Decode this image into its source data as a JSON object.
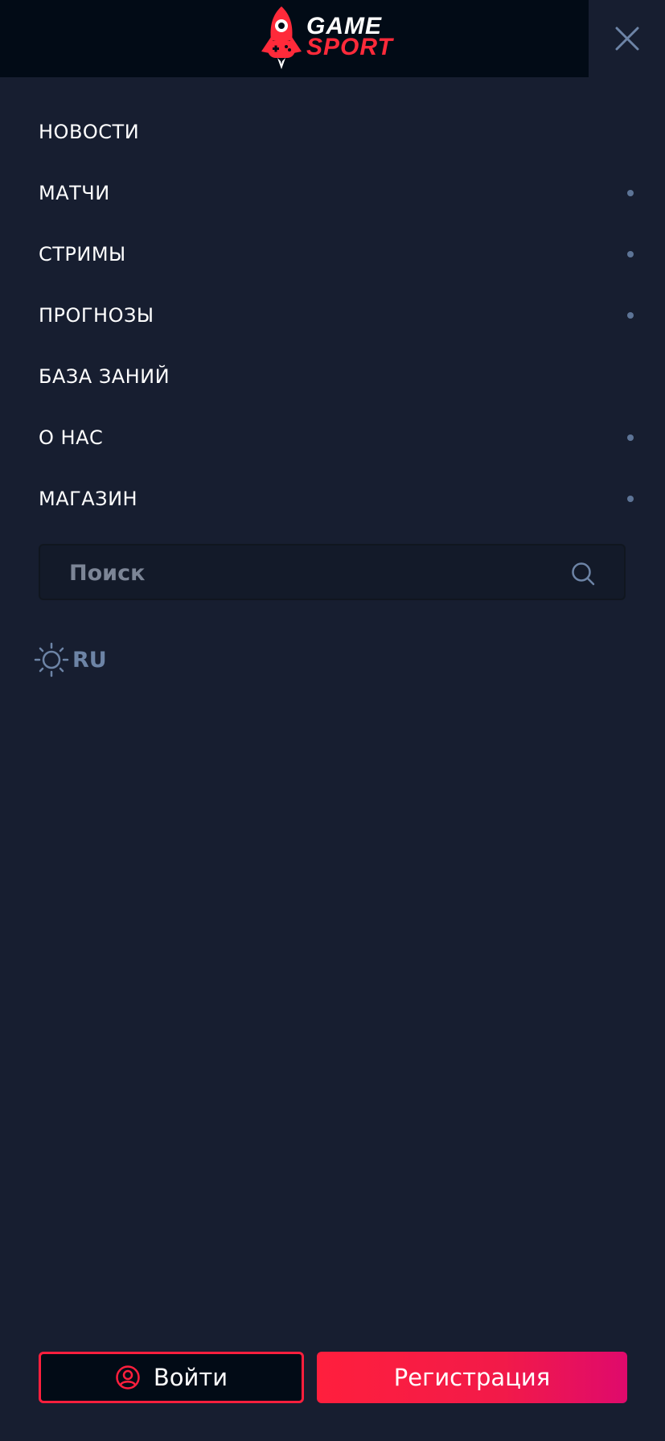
{
  "header": {
    "logo_line1": "GAME",
    "logo_line2": "SPORT",
    "logo_icon": "rocket-gamepad-icon",
    "close_icon": "close-icon"
  },
  "menu": {
    "items": [
      {
        "label": "НОВОСТИ",
        "has_dot": false
      },
      {
        "label": "МАТЧИ",
        "has_dot": true
      },
      {
        "label": "СТРИМЫ",
        "has_dot": true
      },
      {
        "label": "ПРОГНОЗЫ",
        "has_dot": true
      },
      {
        "label": "БАЗА ЗАНИЙ",
        "has_dot": false
      },
      {
        "label": "О НАС",
        "has_dot": true
      },
      {
        "label": "МАГАЗИН",
        "has_dot": true
      }
    ]
  },
  "search": {
    "placeholder": "Поиск",
    "value": "",
    "icon": "search-icon"
  },
  "language": {
    "theme_icon": "sun-icon",
    "code": "RU"
  },
  "auth": {
    "login_label": "Войти",
    "login_icon": "user-circle-icon",
    "register_label": "Регистрация"
  },
  "colors": {
    "background": "#171e30",
    "header": "#020b16",
    "accent": "#ff1f3d",
    "accent_end": "#df0a6c",
    "muted": "#6d84a6"
  }
}
